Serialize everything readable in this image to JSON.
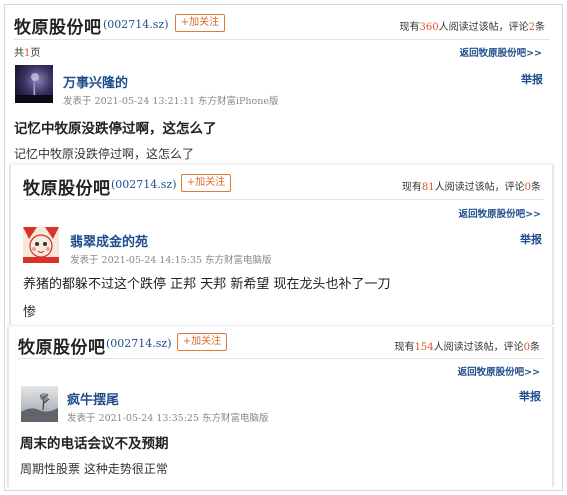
{
  "posts": [
    {
      "bar_name": "牧原股份吧",
      "stock_code": "(002714.sz)",
      "follow_label": "+加关注",
      "stats": {
        "prefix": "现有",
        "views": "360",
        "middle": "人阅读过该帖，评论",
        "comments": "2",
        "suffix": "条"
      },
      "pages": {
        "prefix": "共",
        "count": "1",
        "suffix": "页"
      },
      "back_link": "返回牧原股份吧>>",
      "user": "万事兴隆的",
      "report": "举报",
      "meta": "发表于 2021-05-24 13:21:11 东方财富iPhone版",
      "title": "记忆中牧原没跌停过啊，这怎么了",
      "body": "记忆中牧原没跌停过啊，这怎么了",
      "avatar_icon": "night-scene-avatar-icon"
    },
    {
      "bar_name": "牧原股份吧",
      "stock_code": "(002714.sz)",
      "follow_label": "+加关注",
      "stats": {
        "prefix": "现有",
        "views": "81",
        "middle": "人阅读过该帖，评论",
        "comments": "0",
        "suffix": "条"
      },
      "back_link": "返回牧原股份吧>>",
      "user": "翡翠成金的苑",
      "report": "举报",
      "meta": "发表于 2021-05-24 14:15:35 东方财富电脑版",
      "title": "养猪的都躲不过这个跌停 正邦 天邦 新希望 现在龙头也补了一刀",
      "body": "惨",
      "avatar_icon": "cartoon-avatar-icon"
    },
    {
      "bar_name": "牧原股份吧",
      "stock_code": "(002714.sz)",
      "follow_label": "+加关注",
      "stats": {
        "prefix": "现有",
        "views": "154",
        "middle": "人阅读过该帖，评论",
        "comments": "0",
        "suffix": "条"
      },
      "back_link": "返回牧原股份吧>>",
      "user": "疯牛摆尾",
      "report": "举报",
      "meta": "发表于 2021-05-24 13:35:25 东方财富电脑版",
      "title": "周末的电话会议不及预期",
      "body": "周期性股票 这种走势很正常",
      "avatar_icon": "foggy-tree-avatar-icon"
    }
  ],
  "colors": {
    "link": "#1f4e8c",
    "accent": "#e0542a",
    "follow_border": "#e07a3a"
  }
}
